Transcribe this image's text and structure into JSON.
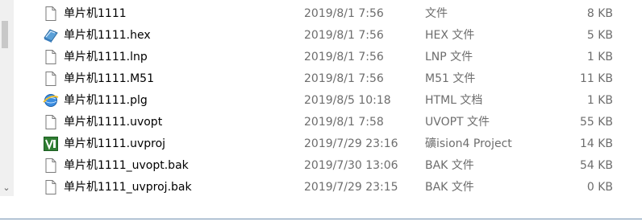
{
  "files": [
    {
      "name": "单片机1111",
      "date": "2019/8/1 7:56",
      "type": "文件",
      "size": "8 KB",
      "icon": "file-icon"
    },
    {
      "name": "单片机1111.hex",
      "date": "2019/8/1 7:56",
      "type": "HEX 文件",
      "size": "5 KB",
      "icon": "hex-file-icon"
    },
    {
      "name": "单片机1111.lnp",
      "date": "2019/8/1 7:56",
      "type": "LNP 文件",
      "size": "1 KB",
      "icon": "file-icon"
    },
    {
      "name": "单片机1111.M51",
      "date": "2019/8/1 7:56",
      "type": "M51 文件",
      "size": "11 KB",
      "icon": "file-icon"
    },
    {
      "name": "单片机1111.plg",
      "date": "2019/8/5 10:18",
      "type": "HTML 文档",
      "size": "1 KB",
      "icon": "html-file-icon"
    },
    {
      "name": "单片机1111.uvopt",
      "date": "2019/8/1 7:58",
      "type": "UVOPT 文件",
      "size": "55 KB",
      "icon": "file-icon"
    },
    {
      "name": "单片机1111.uvproj",
      "date": "2019/7/29 23:16",
      "type": "礦ision4 Project",
      "size": "14 KB",
      "icon": "uvision-project-icon"
    },
    {
      "name": "单片机1111_uvopt.bak",
      "date": "2019/7/30 13:06",
      "type": "BAK 文件",
      "size": "54 KB",
      "icon": "file-icon"
    },
    {
      "name": "单片机1111_uvproj.bak",
      "date": "2019/7/29 23:15",
      "type": "BAK 文件",
      "size": "0 KB",
      "icon": "file-icon"
    }
  ]
}
